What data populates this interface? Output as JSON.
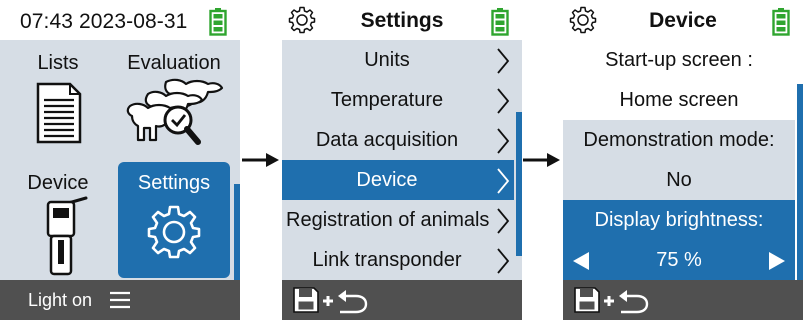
{
  "screen1": {
    "time": "07:43",
    "date": "2023-08-31",
    "tiles": {
      "lists": "Lists",
      "evaluation": "Evaluation",
      "device": "Device",
      "settings": "Settings"
    },
    "bottom_text": "Light on"
  },
  "screen2": {
    "title": "Settings",
    "items": [
      {
        "label": "Units"
      },
      {
        "label": "Temperature"
      },
      {
        "label": "Data acquisition"
      },
      {
        "label": "Device"
      },
      {
        "label": "Registration of animals"
      },
      {
        "label": "Link transponder"
      }
    ]
  },
  "screen3": {
    "title": "Device",
    "startup_label": "Start-up screen :",
    "startup_value": "Home screen",
    "demo_label": "Demonstration mode:",
    "demo_value": "No",
    "brightness_label": "Display brightness:",
    "brightness_value": "75 %"
  },
  "colors": {
    "accent": "#1f6fae",
    "panel_bg": "#d6dde5",
    "bar_bg": "#505050",
    "battery": "#2fa52f"
  },
  "icons": [
    "gear-icon",
    "battery-icon",
    "chevron-right-icon",
    "save-icon",
    "undo-icon",
    "menu-icon",
    "arrow-left-icon",
    "arrow-right-icon"
  ]
}
